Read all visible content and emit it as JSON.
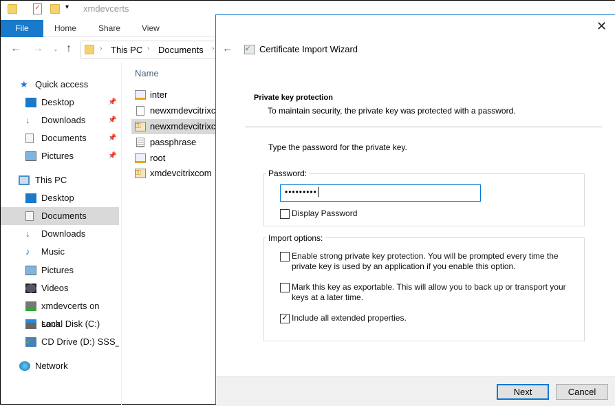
{
  "window": {
    "title": "xmdevcerts"
  },
  "ribbon": {
    "tabs": [
      "File",
      "Home",
      "Share",
      "View"
    ]
  },
  "address": {
    "crumbs": [
      "This PC",
      "Documents"
    ]
  },
  "sidebar": {
    "quick_access": {
      "label": "Quick access",
      "items": [
        {
          "label": "Desktop",
          "icon": "desktop-icon"
        },
        {
          "label": "Downloads",
          "icon": "downloads-icon"
        },
        {
          "label": "Documents",
          "icon": "documents-icon"
        },
        {
          "label": "Pictures",
          "icon": "pictures-icon"
        }
      ]
    },
    "this_pc": {
      "label": "This PC",
      "items": [
        {
          "label": "Desktop"
        },
        {
          "label": "Documents",
          "selected": true
        },
        {
          "label": "Downloads"
        },
        {
          "label": "Music"
        },
        {
          "label": "Pictures"
        },
        {
          "label": "Videos"
        },
        {
          "label": "xmdevcerts on sank"
        },
        {
          "label": "Local Disk (C:)"
        },
        {
          "label": "CD Drive (D:) SSS_X("
        }
      ]
    },
    "network": {
      "label": "Network"
    }
  },
  "files": {
    "column": "Name",
    "items": [
      {
        "name": "inter",
        "icon": "certificate-icon"
      },
      {
        "name": "newxmdevcitrixcom",
        "icon": "file-icon"
      },
      {
        "name": "newxmdevcitrixcom",
        "icon": "pfx-key-icon",
        "selected": true
      },
      {
        "name": "passphrase",
        "icon": "text-file-icon"
      },
      {
        "name": "root",
        "icon": "certificate-icon"
      },
      {
        "name": "xmdevcitrixcom",
        "icon": "pfx-key-icon"
      }
    ]
  },
  "wizard": {
    "title": "Certificate Import Wizard",
    "heading": "Private key protection",
    "subheading": "To maintain security, the private key was protected with a password.",
    "prompt": "Type the password for the private key.",
    "password_group": "Password:",
    "password_value": "•••••••••",
    "display_password": {
      "label": "Display Password",
      "checked": false
    },
    "import_group": "Import options:",
    "options": [
      {
        "label": "Enable strong private key protection. You will be prompted every time the private key is used by an application if you enable this option.",
        "checked": false
      },
      {
        "label": "Mark this key as exportable. This will allow you to back up or transport your keys at a later time.",
        "checked": false
      },
      {
        "label": "Include all extended properties.",
        "checked": true
      }
    ],
    "next": "Next",
    "cancel": "Cancel"
  },
  "colors": {
    "accent": "#1979ca",
    "selection": "#d9d9d9"
  }
}
